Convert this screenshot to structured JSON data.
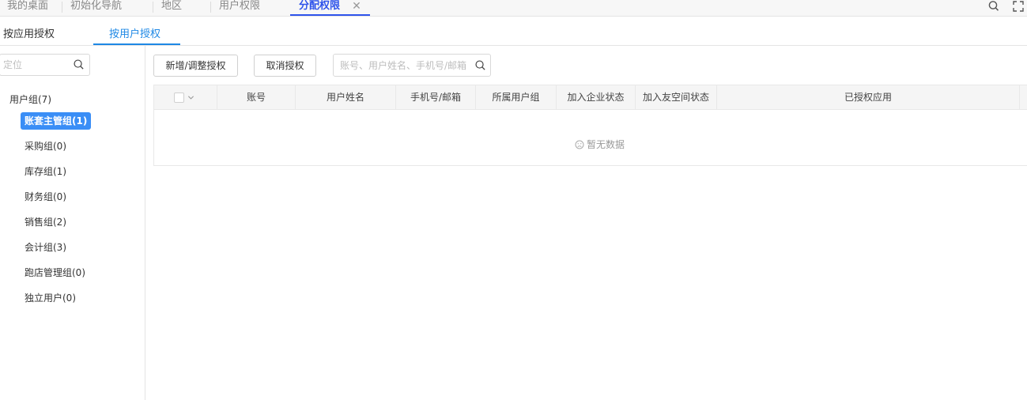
{
  "top_tabs": [
    {
      "label": "我的桌面",
      "active": false
    },
    {
      "label": "初始化导航",
      "active": false
    },
    {
      "label": "地区",
      "active": false
    },
    {
      "label": "用户权限",
      "active": false
    },
    {
      "label": "分配权限",
      "active": true
    }
  ],
  "top_icons": [
    "search-icon",
    "fullscreen-icon"
  ],
  "sub_tabs": [
    {
      "label": "按应用授权",
      "active": false
    },
    {
      "label": "按用户授权",
      "active": true
    }
  ],
  "sidebar": {
    "locate_placeholder": "定位",
    "root_label": "用户组(7)",
    "groups": [
      {
        "label": "账套主管组(1)",
        "selected": true
      },
      {
        "label": "采购组(0)",
        "selected": false
      },
      {
        "label": "库存组(1)",
        "selected": false
      },
      {
        "label": "财务组(0)",
        "selected": false
      },
      {
        "label": "销售组(2)",
        "selected": false
      },
      {
        "label": "会计组(3)",
        "selected": false
      },
      {
        "label": "跑店管理组(0)",
        "selected": false
      },
      {
        "label": "独立用户(0)",
        "selected": false
      }
    ]
  },
  "toolbar": {
    "add_adjust_label": "新增/调整授权",
    "cancel_label": "取消授权",
    "search_placeholder": "账号、用户姓名、手机号/邮箱"
  },
  "table": {
    "columns": [
      "账号",
      "用户姓名",
      "手机号/邮箱",
      "所属用户组",
      "加入企业状态",
      "加入友空间状态",
      "已授权应用"
    ],
    "rows": [],
    "empty_text": "暂无数据"
  },
  "colors": {
    "accent": "#2f54eb",
    "subtab_accent": "#1e88e5",
    "selected_bg": "#3a8ef6"
  }
}
